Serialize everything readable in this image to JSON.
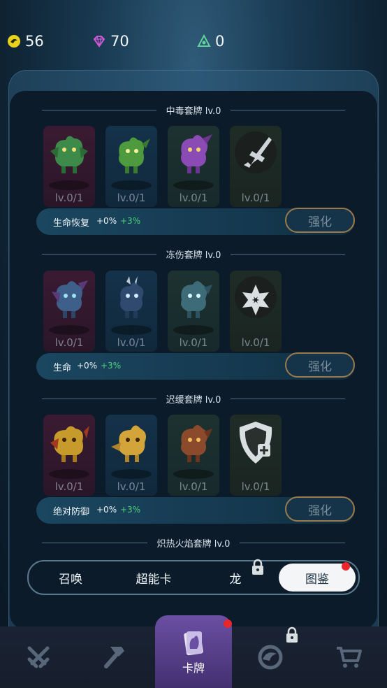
{
  "resources": {
    "coins": {
      "icon": "coin-icon",
      "value": "56"
    },
    "gems": {
      "icon": "gem-icon",
      "value": "70"
    },
    "tokens": {
      "icon": "triangle-token-icon",
      "value": "0"
    }
  },
  "sets": [
    {
      "title": "中毒套牌 lv.0",
      "cards": [
        {
          "name": "green-dragon-1",
          "level": "lv.0/1",
          "color": "#3d8a4a"
        },
        {
          "name": "green-dragon-2",
          "level": "lv.0/1",
          "color": "#4e9a3e"
        },
        {
          "name": "purple-dragon",
          "level": "lv.0/1",
          "color": "#8b4bb5"
        },
        {
          "name": "poison-emblem",
          "level": "lv.0/1",
          "emblem": "dagger-icon"
        }
      ],
      "stat": {
        "name": "生命恢复",
        "pct": "+0%",
        "bonus": "+3%"
      },
      "button": "强化"
    },
    {
      "title": "冻伤套牌 lv.0",
      "cards": [
        {
          "name": "dark-blue-dragon",
          "level": "lv.0/1",
          "color": "#3e5f8a"
        },
        {
          "name": "navy-dragon",
          "level": "lv.0/1",
          "color": "#2f4a6e"
        },
        {
          "name": "teal-dragon",
          "level": "lv.0/1",
          "color": "#3e6b78"
        },
        {
          "name": "frost-emblem",
          "level": "lv.0/1",
          "emblem": "snowflake-icon"
        }
      ],
      "stat": {
        "name": "生命",
        "pct": "+0%",
        "bonus": "+3%"
      },
      "button": "强化"
    },
    {
      "title": "迟缓套牌 lv.0",
      "cards": [
        {
          "name": "gold-dragon-1",
          "level": "lv.0/1",
          "color": "#c79a2c"
        },
        {
          "name": "gold-dragon-2",
          "level": "lv.0/1",
          "color": "#d3a43a"
        },
        {
          "name": "brown-dragon",
          "level": "lv.0/1",
          "color": "#8c4a2c"
        },
        {
          "name": "slow-emblem",
          "level": "lv.0/1",
          "emblem": "shield-plus-icon"
        }
      ],
      "stat": {
        "name": "绝对防御",
        "pct": "+0%",
        "bonus": "+3%"
      },
      "button": "强化"
    }
  ],
  "next_set_title": "炽热火焰套牌 lv.0",
  "tabs": [
    {
      "label": "召唤",
      "active": false,
      "locked": false
    },
    {
      "label": "超能卡",
      "active": false,
      "locked": false
    },
    {
      "label": "龙",
      "active": false,
      "locked": true
    },
    {
      "label": "图鉴",
      "active": true,
      "locked": false,
      "notify": true
    }
  ],
  "nav": [
    {
      "icon": "crossed-swords-icon",
      "label": ""
    },
    {
      "icon": "hammer-icon",
      "label": ""
    },
    {
      "icon": "card-icon",
      "label": "卡牌",
      "active": true,
      "notify": true
    },
    {
      "icon": "portal-icon",
      "label": "",
      "locked": true
    },
    {
      "icon": "shop-cart-icon",
      "label": ""
    }
  ]
}
